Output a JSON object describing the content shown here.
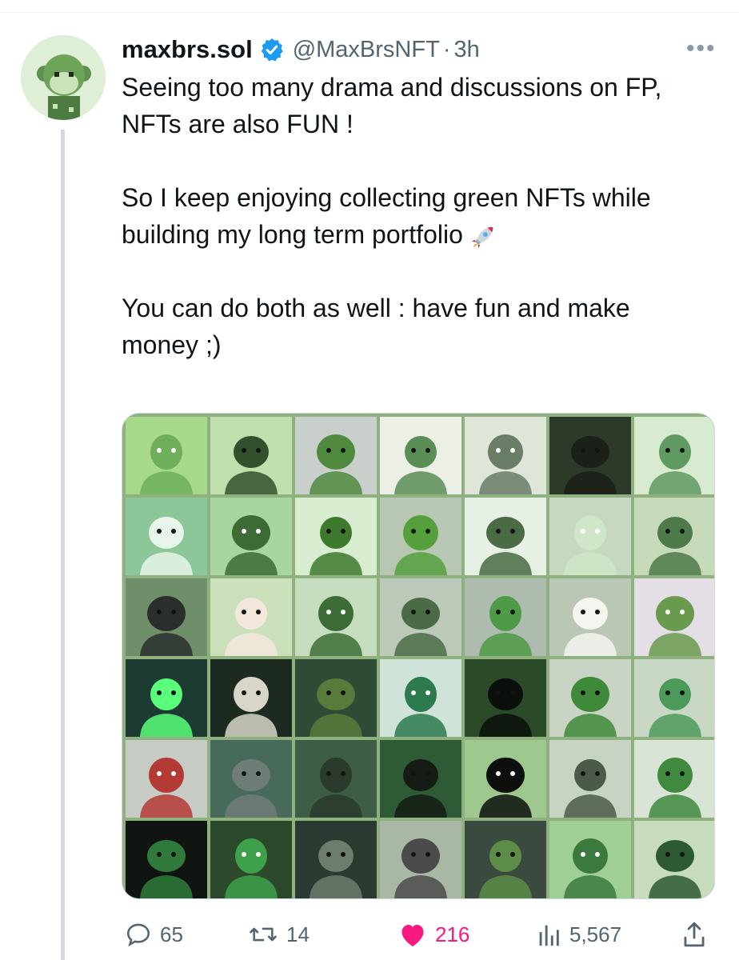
{
  "tweet": {
    "display_name": "maxbrs.sol",
    "handle": "@MaxBrsNFT",
    "separator": "·",
    "time": "3h",
    "more_label": "•••",
    "text": "Seeing too many drama and discussions on FP,\nNFTs are also FUN !\n\nSo I keep enjoying collecting green NFTs while building my long term portfolio",
    "text_end": "You can do both as well : have fun and make money ;)",
    "emoji_icon": "rocket-icon"
  },
  "media": {
    "rows": 6,
    "columns": 7,
    "tile_colors": [
      "#a6d98a",
      "#bfe0ac",
      "#c9d0cc",
      "#ecefe6",
      "#dfe6d9",
      "#2d3a2a",
      "#d8ead0",
      "#8cc79a",
      "#a8d5a0",
      "#d8ecd0",
      "#b8c7b4",
      "#e7f0e4",
      "#c7d8c0",
      "#c6d9b8",
      "#6f8f6a",
      "#c9e0bb",
      "#c7ddc0",
      "#bcc8b8",
      "#aebcb0",
      "#bac7b4",
      "#e4dfe7",
      "#1d3b32",
      "#1c2a1f",
      "#2f4a35",
      "#cfe3d8",
      "#2a4a28",
      "#c9d4c4",
      "#c8d8c5",
      "#c6cbc3",
      "#476a5a",
      "#3d5e44",
      "#2f5a36",
      "#9fc88e",
      "#c7d3c3",
      "#d9e3d6",
      "#101410",
      "#2c4a2b",
      "#2b3a31",
      "#a9b8a4",
      "#3b4a3e",
      "#9fcf95",
      "#c7dbbd"
    ],
    "figure_colors": [
      "#6fae5a",
      "#33502d",
      "#4f8a3f",
      "#5b8d56",
      "#6a7d66",
      "#1b2019",
      "#5f9a63",
      "#e8f5ea",
      "#3e6a34",
      "#3d7a2e",
      "#55a03d",
      "#4a6b43",
      "#cfe6c8",
      "#4e7a4a",
      "#2a2f2d",
      "#f4e7dc",
      "#3d6d37",
      "#4b6b47",
      "#4f9a46",
      "#f3f5ee",
      "#6a9a4e",
      "#59ff7a",
      "#d8d6c8",
      "#587a3a",
      "#2c7b4f",
      "#0b0f0b",
      "#3e8a3a",
      "#4e9a5a",
      "#b43b35",
      "#6e7d76",
      "#2a3a2c",
      "#141c14",
      "#0c0f0c",
      "#4c5a4a",
      "#3f8a3f",
      "#2f7a3a",
      "#3ea04a",
      "#6c7d6e",
      "#4b4b4b",
      "#5c8c47",
      "#3b7a3d",
      "#2e5a33"
    ]
  },
  "actions": {
    "replies": "65",
    "retweets": "14",
    "likes": "216",
    "views": "5,567",
    "icons": [
      "reply-icon",
      "retweet-icon",
      "heart-icon",
      "views-icon",
      "share-icon"
    ]
  },
  "colors": {
    "verified": "#1d9bf0",
    "like": "#f91880",
    "secondary_text": "#536471"
  }
}
